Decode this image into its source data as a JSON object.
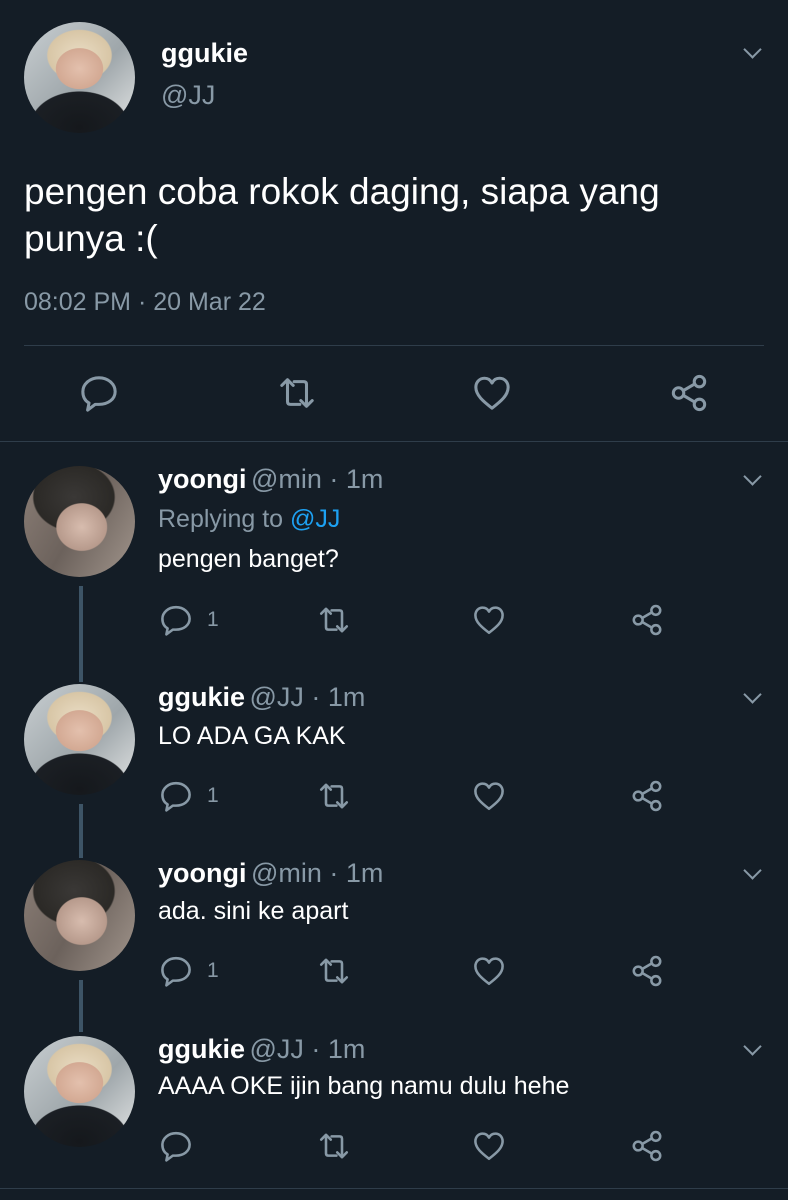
{
  "main_tweet": {
    "name": "ggukie",
    "handle": "@JJ",
    "text_line1": "pengen coba rokok daging, siapa yang",
    "text_line2": "punya :(",
    "timestamp": "08:02 PM · 20 Mar 22"
  },
  "replies": [
    {
      "name": "yoongi",
      "meta": "@min · 1m",
      "replying_prefix": "Replying to",
      "replying_handle": "@JJ",
      "text": "pengen banget?",
      "reply_count": "1"
    },
    {
      "name": "ggukie",
      "meta": "@JJ · 1m",
      "text": "LO ADA GA KAK",
      "reply_count": "1"
    },
    {
      "name": "yoongi",
      "meta": "@min · 1m",
      "text": "ada. sini ke apart",
      "reply_count": "1"
    },
    {
      "name": "ggukie",
      "meta": "@JJ · 1m",
      "text": "AAAA OKE ijin bang namu dulu hehe",
      "reply_count": ""
    }
  ],
  "colors": {
    "background": "#141d26",
    "text": "#ffffff",
    "secondary": "#8899a6",
    "link": "#1da1f2",
    "thread_line": "#3d5466"
  },
  "icons": [
    "chevron-down-icon",
    "reply-icon",
    "retweet-icon",
    "like-icon",
    "share-icon"
  ]
}
